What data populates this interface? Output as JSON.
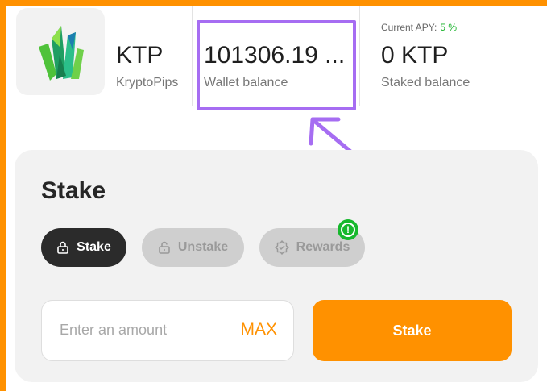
{
  "token": {
    "symbol": "KTP",
    "name": "KryptoPips",
    "logo_icon": "green-crystal-icon"
  },
  "wallet": {
    "value": "101306.19 ...",
    "label": "Wallet balance"
  },
  "staking": {
    "apy_label": "Current APY:",
    "apy_value": "5 %",
    "staked_value": "0 KTP",
    "staked_label": "Staked balance"
  },
  "card": {
    "title": "Stake",
    "tabs": [
      {
        "label": "Stake",
        "icon": "lock-icon",
        "active": true
      },
      {
        "label": "Unstake",
        "icon": "unlock-icon",
        "active": false
      },
      {
        "label": "Rewards",
        "icon": "badge-icon",
        "active": false
      }
    ],
    "amount_placeholder": "Enter an amount",
    "max_label": "MAX",
    "submit_label": "Stake"
  },
  "colors": {
    "accent": "#ff9100",
    "highlight": "#a66df2",
    "apy": "#19b32b",
    "notification": "#17b82d",
    "active_tab": "#2b2b2b"
  }
}
